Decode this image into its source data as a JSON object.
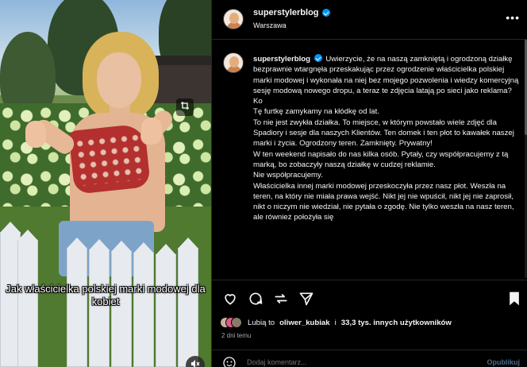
{
  "video": {
    "overlay_text": "Jak właścicielka polskiej marki modowej dla kobiet"
  },
  "post": {
    "username": "superstylerblog",
    "location": "Warszawa",
    "caption_paragraphs": [
      "Uwierzycie, że na naszą zamkniętą i ogrodzoną działkę bezprawnie wtargnęła przeskakując przez ogrodzenie właścicielka polskiej marki modowej i wykonała na niej bez mojego pozwolenia i wiedzy komercyjną sesję modową nowego dropu, a teraz te zdjęcia latają po sieci jako reklama?",
      "Ko",
      "Tę furtkę zamykamy na kłódkę od lat.",
      "To nie jest zwykła działka. To miejsce, w którym powstało wiele zdjęć dla Spadiory i sesje dla naszych Klientów. Ten domek i ten płot to kawałek naszej marki i życia. Ogrodzony teren. Zamknięty. Prywatny!",
      "W ten weekend napisało do nas kilka osób. Pytały, czy współpracujemy z tą marką, bo zobaczyły naszą działkę w cudzej reklamie.",
      "Nie współpracujemy.",
      "Właścicielka innej marki modowej przeskoczyła przez nasz płot. Weszła na teren, na który nie miała prawa wejść. Nikt jej nie wpuścił, nikt jej nie zaprosił, nikt o niczym nie wiedział, nie pytała o zgodę. Nie tylko weszła na nasz teren, ale również położyła się"
    ],
    "likes_prefix": "Lubią to",
    "likes_user": "oliwer_kubiak",
    "likes_middle": "i",
    "likes_count": "33,3 tys. innych użytkowników",
    "time": "2 dni temu",
    "comment_placeholder": "Dodaj komentarz...",
    "publish_label": "Opublikuj"
  },
  "icons": [
    "more-icon",
    "verified-icon",
    "heart-icon",
    "comment-icon",
    "share-icon",
    "send-icon",
    "bookmark-icon",
    "emoji-icon",
    "crop-icon",
    "mute-icon"
  ],
  "colors": {
    "background": "#000000",
    "text": "#f5f5f5",
    "muted": "#a8a8a8",
    "verified": "#0095f6",
    "publish": "#4a6b8a"
  }
}
